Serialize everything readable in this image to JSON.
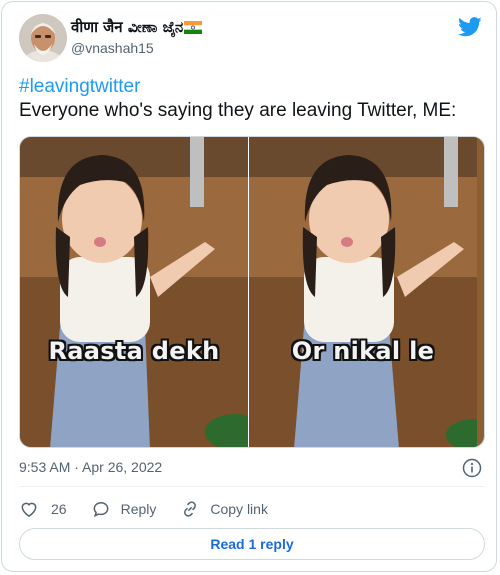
{
  "author": {
    "display_name": "वीणा जैन ವೀಣಾ ಜೈನ",
    "handle": "@vnashah15",
    "avatar_icon": "profile-photo",
    "flag_icon": "india-flag"
  },
  "tweet": {
    "hashtag": "#leavingtwitter",
    "text": "Everyone who's saying they are leaving Twitter, ME:",
    "media": {
      "left_caption": "Raasta dekh",
      "right_caption": "Or nikal le"
    },
    "timestamp": "9:53 AM · Apr 26, 2022"
  },
  "actions": {
    "like_count": "26",
    "reply_label": "Reply",
    "copy_label": "Copy link"
  },
  "footer": {
    "read_replies_label": "Read 1 reply"
  },
  "colors": {
    "brand": "#1d9bf0",
    "text": "#0f1419",
    "muted": "#536471"
  }
}
